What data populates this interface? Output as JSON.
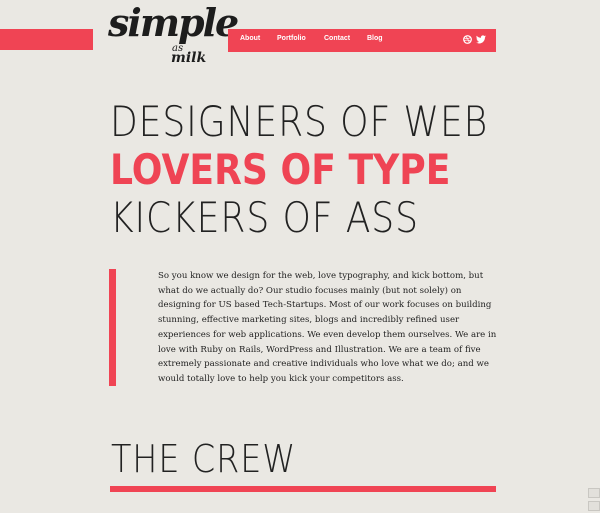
{
  "logo": {
    "main": "simple",
    "as": "as",
    "milk": "milk"
  },
  "nav": {
    "items": [
      {
        "label": "About"
      },
      {
        "label": "Portfolio"
      },
      {
        "label": "Contact"
      },
      {
        "label": "Blog"
      }
    ],
    "icons": [
      "dribbble-icon",
      "twitter-icon"
    ]
  },
  "hero": {
    "line1": "DESIGNERS OF WEB",
    "line2": "LOVERS OF TYPE",
    "line3": "KICKERS OF ASS"
  },
  "intro": {
    "text": "So you know we design for the web, love typography, and kick bottom, but what do we actually do? Our studio focuses mainly (but not solely) on designing for US based Tech-Startups. Most of our work focuses on building stunning, effective marketing sites, blogs and incredibly refined user experiences for web applications. We even develop them ourselves. We are in love with Ruby on Rails, WordPress and Illustration. We are a team of five extremely passionate and creative individuals who love what we do; and we would totally love to help you kick your competitors ass."
  },
  "crew": {
    "title": "THE CREW"
  },
  "colors": {
    "accent": "#f04454",
    "background": "#eae8e3",
    "text": "#222222"
  }
}
